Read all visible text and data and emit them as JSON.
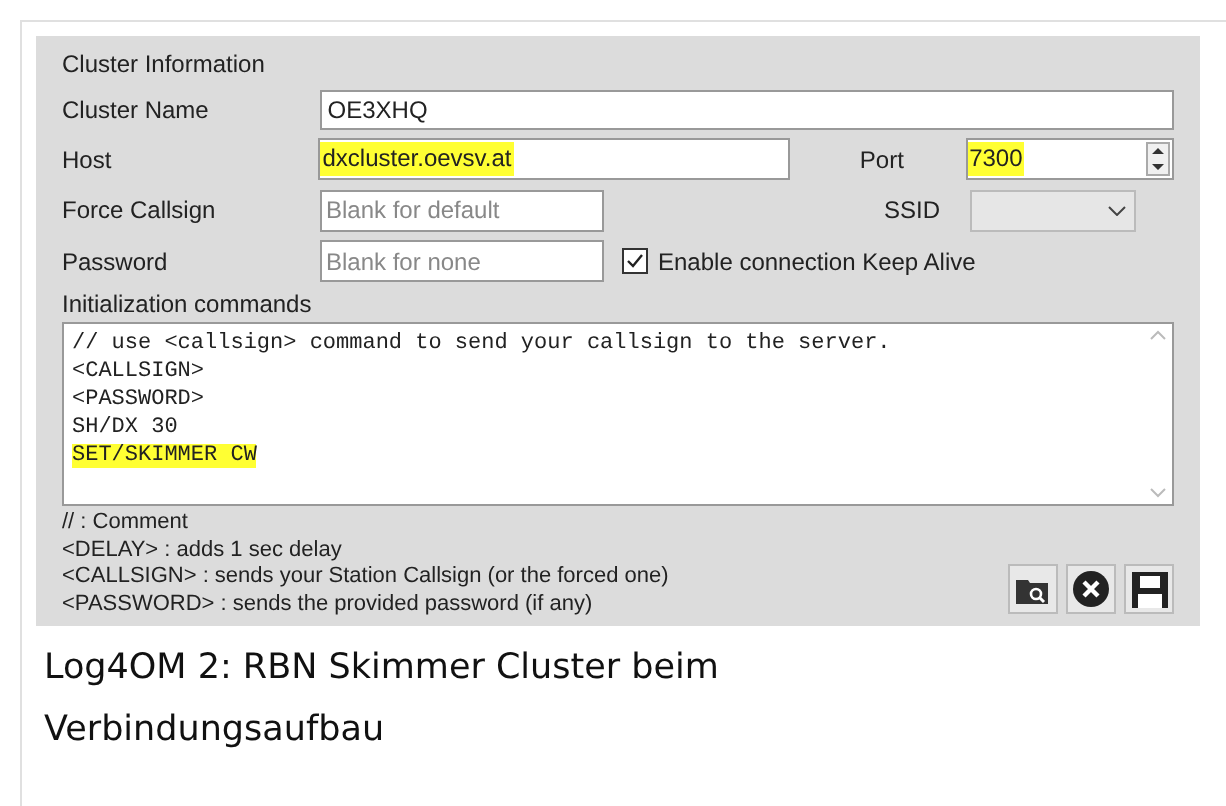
{
  "panel": {
    "title": "Cluster Information"
  },
  "fields": [
    {
      "label": "Cluster Name",
      "value": "OE3XHQ",
      "highlighted": false
    },
    {
      "label": "Host",
      "value": "dxcluster.oevsv.at",
      "highlighted": true
    },
    {
      "label": "Port",
      "value": "7300",
      "highlighted": true
    },
    {
      "label": "Force Callsign",
      "placeholder": "Blank for default"
    },
    {
      "label": "SSID"
    },
    {
      "label": "Password",
      "placeholder": "Blank for none"
    }
  ],
  "keep_alive": {
    "label": "Enable connection Keep Alive",
    "checked": true
  },
  "init_commands": {
    "label": "Initialization commands",
    "lines": [
      {
        "text": "// use <callsign> command to send your callsign to the server.",
        "highlighted": false
      },
      {
        "text": "<CALLSIGN>",
        "highlighted": false
      },
      {
        "text": "<PASSWORD>",
        "highlighted": false
      },
      {
        "text": "SH/DX 30",
        "highlighted": false
      },
      {
        "text": "SET/SKIMMER CW",
        "highlighted": true
      }
    ]
  },
  "help_lines": [
    "// : Comment",
    "<DELAY> : adds 1 sec delay",
    "<CALLSIGN> : sends your Station Callsign (or the forced one)",
    "<PASSWORD> : sends the provided password (if any)"
  ],
  "caption": "Log4OM 2: RBN Skimmer Cluster beim Verbindungsaufbau"
}
